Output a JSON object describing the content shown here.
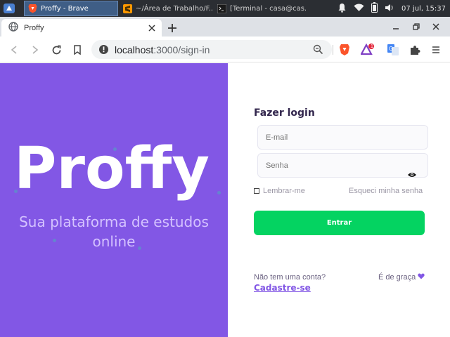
{
  "taskbar": {
    "tasks": [
      {
        "label": "Proffy - Brave",
        "icon": "brave-icon"
      },
      {
        "label": "~/Área de Trabalho/F...",
        "icon": "sublime-icon"
      },
      {
        "label": "[Terminal - casa@cas...",
        "icon": "terminal-icon"
      }
    ],
    "clock": "07 jul, 15:37"
  },
  "browser": {
    "tab_title": "Proffy",
    "url_host": "localhost",
    "url_rest": ":3000/sign-in",
    "rewards_badge": "1"
  },
  "hero": {
    "logo_text": "Proffy",
    "tagline_line1": "Sua plataforma de estudos",
    "tagline_line2": "online",
    "background_color": "#8257e5"
  },
  "login": {
    "title": "Fazer login",
    "email_placeholder": "E-mail",
    "password_placeholder": "Senha",
    "remember_label": "Lembrar-me",
    "forgot_label": "Esqueci minha senha",
    "submit_label": "Entrar",
    "submit_color": "#04d361",
    "no_account_label": "Não tem uma conta?",
    "signup_label": "Cadastre-se",
    "free_label": "É de graça"
  }
}
